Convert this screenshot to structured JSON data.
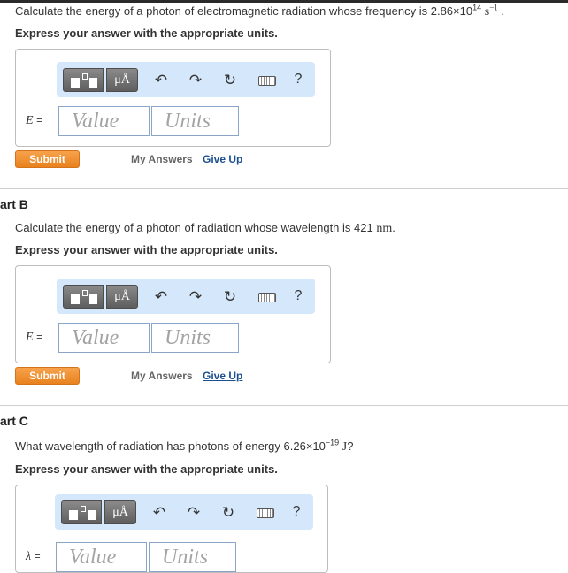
{
  "part_a": {
    "question_prefix": "Calculate the energy of a photon of electromagnetic radiation whose frequency is 2.86×10",
    "question_exp": "14",
    "question_unit": "s",
    "question_unit_exp": "−1",
    "question_suffix": ".",
    "instruction": "Express your answer with the appropriate units.",
    "lhs_var": "E",
    "lhs_eq": "=",
    "value_placeholder": "Value",
    "units_placeholder": "Units",
    "submit_label": "Submit",
    "my_answers_label": "My Answers",
    "give_up_label": "Give Up"
  },
  "part_b": {
    "label": "art B",
    "question_prefix": "Calculate the energy of a photon of radiation whose wavelength is 421",
    "question_unit": "nm",
    "question_suffix": ".",
    "instruction": "Express your answer with the appropriate units.",
    "lhs_var": "E",
    "lhs_eq": "=",
    "value_placeholder": "Value",
    "units_placeholder": "Units",
    "submit_label": "Submit",
    "my_answers_label": "My Answers",
    "give_up_label": "Give Up"
  },
  "part_c": {
    "label": "art C",
    "question_prefix": "What wavelength of radiation has photons of energy 6.26×10",
    "question_exp": "−19",
    "question_unit": "J",
    "question_suffix": "?",
    "instruction": "Express your answer with the appropriate units.",
    "lhs_var": "λ",
    "lhs_eq": "=",
    "value_placeholder": "Value",
    "units_placeholder": "Units"
  },
  "toolbar": {
    "units_glyph": "μÅ",
    "undo_glyph": "↶",
    "redo_glyph": "↷",
    "reset_glyph": "↻",
    "help_glyph": "?",
    "icons": [
      "template-icon",
      "units-icon",
      "undo-icon",
      "redo-icon",
      "reset-icon",
      "keyboard-icon",
      "help-icon"
    ]
  },
  "colors": {
    "submit": "#e8821f",
    "toolbar_bg": "#d5e7fb",
    "link": "#1c4f8f"
  }
}
